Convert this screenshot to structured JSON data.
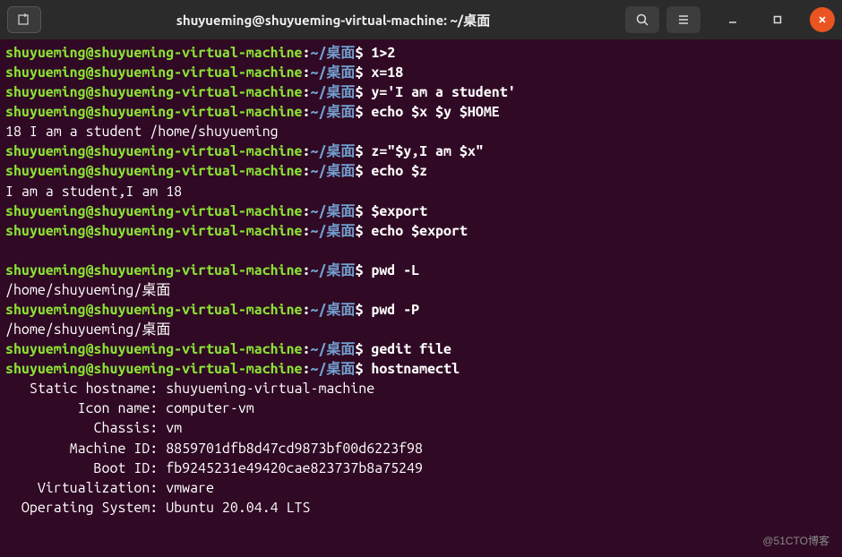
{
  "titlebar": {
    "title": "shuyueming@shuyueming-virtual-machine: ~/桌面"
  },
  "prompt": {
    "userhost": "shuyueming@shuyueming-virtual-machine",
    "colon": ":",
    "tilde": "~",
    "path": "/桌面",
    "dollar": "$"
  },
  "lines": {
    "c1": "1>2",
    "c2": "x=18",
    "c3": "y='I am a student'",
    "c4": "echo $x $y $HOME",
    "o4": "18 I am a student /home/shuyueming",
    "c5": "z=\"$y,I am $x\"",
    "c6": "echo $z",
    "o6": "I am a student,I am 18",
    "c7": "$export",
    "c8": "echo $export",
    "o8": "",
    "c9": "pwd -L",
    "o9": "/home/shuyueming/桌面",
    "c10": "pwd -P",
    "o10": "/home/shuyueming/桌面",
    "c11": "gedit file",
    "c12": "hostnamectl",
    "h1": "   Static hostname: shuyueming-virtual-machine",
    "h2": "         Icon name: computer-vm",
    "h3": "           Chassis: vm",
    "h4": "        Machine ID: 8859701dfb8d47cd9873bf00d6223f98",
    "h5": "           Boot ID: fb9245231e49420cae823737b8a75249",
    "h6": "    Virtualization: vmware",
    "h7": "  Operating System: Ubuntu 20.04.4 LTS"
  },
  "watermark": "@51CTO博客"
}
